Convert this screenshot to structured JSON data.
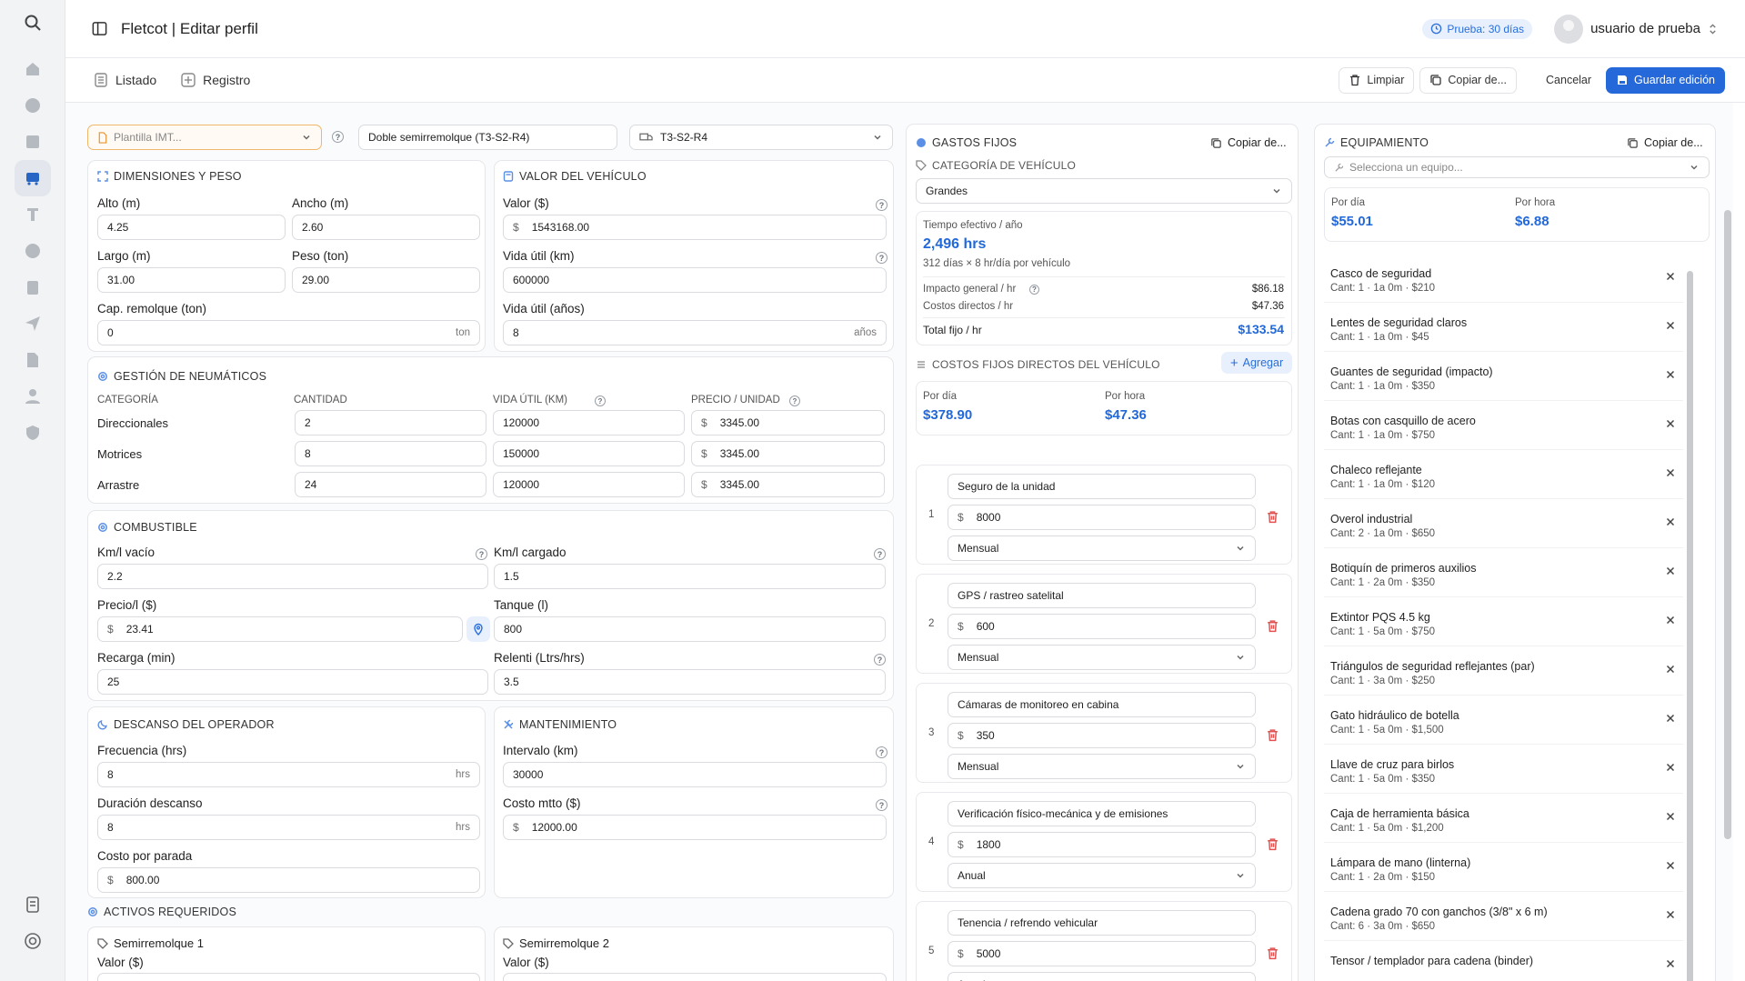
{
  "header": {
    "title": "Fletcot | Editar perfil",
    "trial": "Prueba: 30 días",
    "user": "usuario de prueba"
  },
  "subnav": {
    "list": "Listado",
    "register": "Registro",
    "clear": "Limpiar",
    "copy": "Copiar de...",
    "cancel": "Cancelar",
    "save": "Guardar edición"
  },
  "top_selects": {
    "template": "Plantilla IMT...",
    "vehicle_name": "Doble semirremolque (T3-S2-R4)",
    "vehicle_type": "T3-S2-R4"
  },
  "dimensions": {
    "title": "Dimensiones y peso",
    "alto_label": "Alto (m)",
    "alto": "4.25",
    "ancho_label": "Ancho (m)",
    "ancho": "2.60",
    "largo_label": "Largo (m)",
    "largo": "31.00",
    "peso_label": "Peso (ton)",
    "peso": "29.00",
    "cap_label": "Cap. remolque (ton)",
    "cap": "0",
    "cap_unit": "ton"
  },
  "value": {
    "title": "Valor del vehículo",
    "valor_label": "Valor ($)",
    "valor": "1543168.00",
    "km_label": "Vida útil (km)",
    "km": "600000",
    "anos_label": "Vida útil (años)",
    "anos": "8",
    "anos_unit": "años"
  },
  "tires": {
    "title": "Gestión de neumáticos",
    "headers": [
      "Categoría",
      "Cantidad",
      "Vida útil (km)",
      "Precio / unidad"
    ],
    "rows": [
      {
        "cat": "Direccionales",
        "qty": "2",
        "life": "120000",
        "price": "3345.00"
      },
      {
        "cat": "Motrices",
        "qty": "8",
        "life": "150000",
        "price": "3345.00"
      },
      {
        "cat": "Arrastre",
        "qty": "24",
        "life": "120000",
        "price": "3345.00"
      }
    ]
  },
  "fuel": {
    "title": "Combustible",
    "vacio_label": "Km/l vacío",
    "vacio": "2.2",
    "cargado_label": "Km/l cargado",
    "cargado": "1.5",
    "precio_label": "Precio/l ($)",
    "precio": "23.41",
    "tanque_label": "Tanque (l)",
    "tanque": "800",
    "recarga_label": "Recarga (min)",
    "recarga": "25",
    "relenti_label": "Relenti (Ltrs/hrs)",
    "relenti": "3.5"
  },
  "rest": {
    "title": "Descanso del operador",
    "freq_label": "Frecuencia (hrs)",
    "freq": "8",
    "dur_label": "Duración descanso",
    "dur": "8",
    "unit": "hrs",
    "cost_label": "Costo por parada",
    "cost": "800.00"
  },
  "maint": {
    "title": "Mantenimiento",
    "int_label": "Intervalo (km)",
    "int": "30000",
    "cost_label": "Costo mtto ($)",
    "cost": "12000.00"
  },
  "assets": {
    "title": "Activos requeridos",
    "a1": "Semirremolque 1",
    "a2": "Semirremolque 2",
    "valor_label": "Valor ($)"
  },
  "fixed": {
    "title": "Gastos fijos",
    "copy": "Copiar de...",
    "cat_title": "Categoría de vehículo",
    "cat": "Grandes",
    "eff_label": "Tiempo efectivo / año",
    "eff": "2,496 hrs",
    "eff_note": "312 días × 8 hr/día por vehículo",
    "imp_label": "Impacto general / hr",
    "imp": "$86.18",
    "dir_label": "Costos directos / hr",
    "dir": "$47.36",
    "total_label": "Total fijo / hr",
    "total": "$133.54",
    "direct_title": "Costos fijos directos del vehículo",
    "add": "Agregar",
    "day_label": "Por día",
    "day": "$378.90",
    "hour_label": "Por hora",
    "hour": "$47.36",
    "items": [
      {
        "n": "1",
        "name": "Seguro de la unidad",
        "amount": "8000",
        "freq": "Mensual"
      },
      {
        "n": "2",
        "name": "GPS / rastreo satelital",
        "amount": "600",
        "freq": "Mensual"
      },
      {
        "n": "3",
        "name": "Cámaras de monitoreo en cabina",
        "amount": "350",
        "freq": "Mensual"
      },
      {
        "n": "4",
        "name": "Verificación físico-mecánica y de emisiones",
        "amount": "1800",
        "freq": "Anual"
      },
      {
        "n": "5",
        "name": "Tenencia / refrendo vehicular",
        "amount": "5000",
        "freq": "Anual"
      }
    ]
  },
  "equip": {
    "title": "Equipamiento",
    "copy": "Copiar de...",
    "placeholder": "Selecciona un equipo...",
    "day_label": "Por día",
    "day": "$55.01",
    "hour_label": "Por hora",
    "hour": "$6.88",
    "items": [
      {
        "name": "Casco de seguridad",
        "detail": "Cant: 1 · 1a 0m · $210"
      },
      {
        "name": "Lentes de seguridad claros",
        "detail": "Cant: 1 · 1a 0m · $45"
      },
      {
        "name": "Guantes de seguridad (impacto)",
        "detail": "Cant: 1 · 1a 0m · $350"
      },
      {
        "name": "Botas con casquillo de acero",
        "detail": "Cant: 1 · 1a 0m · $750"
      },
      {
        "name": "Chaleco reflejante",
        "detail": "Cant: 1 · 1a 0m · $120"
      },
      {
        "name": "Overol industrial",
        "detail": "Cant: 2 · 1a 0m · $650"
      },
      {
        "name": "Botiquín de primeros auxilios",
        "detail": "Cant: 1 · 2a 0m · $350"
      },
      {
        "name": "Extintor PQS 4.5 kg",
        "detail": "Cant: 1 · 5a 0m · $750"
      },
      {
        "name": "Triángulos de seguridad reflejantes (par)",
        "detail": "Cant: 1 · 3a 0m · $250"
      },
      {
        "name": "Gato hidráulico de botella",
        "detail": "Cant: 1 · 5a 0m · $1,500"
      },
      {
        "name": "Llave de cruz para birlos",
        "detail": "Cant: 1 · 5a 0m · $350"
      },
      {
        "name": "Caja de herramienta básica",
        "detail": "Cant: 1 · 5a 0m · $1,200"
      },
      {
        "name": "Lámpara de mano (linterna)",
        "detail": "Cant: 1 · 2a 0m · $150"
      },
      {
        "name": "Cadena grado 70 con ganchos (3/8\" x 6 m)",
        "detail": "Cant: 6 · 3a 0m · $650"
      },
      {
        "name": "Tensor / templador para cadena (binder)",
        "detail": ""
      }
    ]
  }
}
